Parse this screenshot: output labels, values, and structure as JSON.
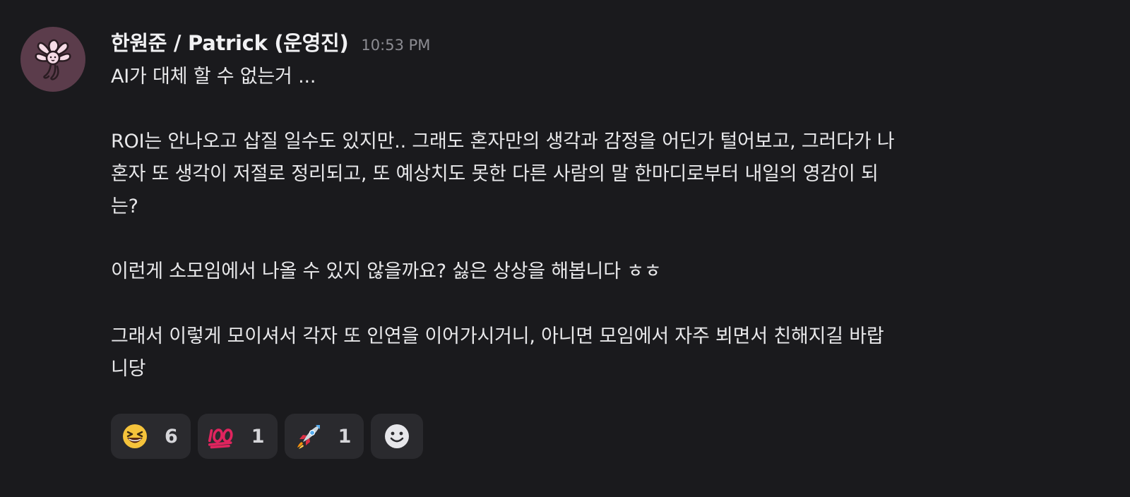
{
  "message": {
    "author": "한원준 / Patrick (운영진)",
    "timestamp": "10:53 PM",
    "avatar_icon": "octopus-avatar-icon",
    "paragraphs": [
      "AI가 대체 할 수 없는거 ...",
      "",
      "ROI는 안나오고 삽질 일수도 있지만.. 그래도 혼자만의 생각과 감정을 어딘가 털어보고, 그러다가 나",
      "혼자 또 생각이 저절로 정리되고, 또 예상치도 못한 다른 사람의 말 한마디로부터 내일의 영감이 되",
      "는?",
      "",
      "이런게 소모임에서 나올 수 있지 않을까요? 싫은 상상을 해봅니다 ㅎㅎ",
      "",
      "그래서 이렇게 모이셔서 각자 또 인연을 이어가시거니, 아니면 모임에서 자주 뵈면서 친해지길 바랍",
      "니당"
    ]
  },
  "reactions": [
    {
      "icon": "grinning-squinting-face-icon",
      "count": "6"
    },
    {
      "icon": "hundred-points-icon",
      "count": "1"
    },
    {
      "icon": "rocket-icon",
      "count": "1"
    }
  ],
  "add_reaction_icon": "add-reaction-smiley-icon",
  "colors": {
    "background": "#1a1a1d",
    "text": "#e8e8ea",
    "timestamp": "#8c8c92",
    "reaction_bg": "#2a2a2e",
    "avatar_bg": "#5b3c4b"
  }
}
